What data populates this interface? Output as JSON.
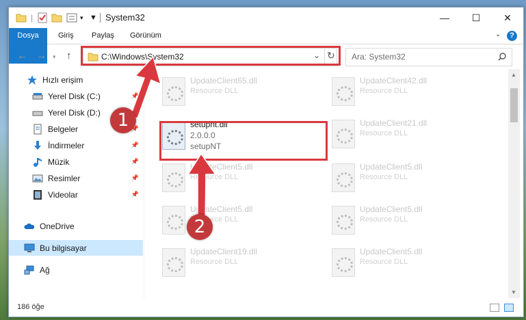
{
  "window": {
    "title": "System32",
    "controls": {
      "minimize": "—",
      "maximize": "☐",
      "close": "✕"
    }
  },
  "ribbon": {
    "tabs": [
      "Dosya",
      "Giriş",
      "Paylaş",
      "Görünüm"
    ],
    "help": "?"
  },
  "nav": {
    "address": "C:\\Windows\\System32",
    "search_placeholder": "Ara: System32"
  },
  "sidebar": {
    "items": [
      {
        "label": "Hızlı erişim",
        "icon": "star-icon",
        "pinned": false
      },
      {
        "label": "Yerel Disk (C:)",
        "icon": "drive-icon",
        "pinned": true
      },
      {
        "label": "Yerel Disk (D:)",
        "icon": "drive-icon",
        "pinned": true
      },
      {
        "label": "Belgeler",
        "icon": "documents-icon",
        "pinned": true
      },
      {
        "label": "İndirmeler",
        "icon": "downloads-icon",
        "pinned": true
      },
      {
        "label": "Müzik",
        "icon": "music-icon",
        "pinned": true
      },
      {
        "label": "Resimler",
        "icon": "pictures-icon",
        "pinned": true
      },
      {
        "label": "Videolar",
        "icon": "videos-icon",
        "pinned": true
      },
      {
        "label": "OneDrive",
        "icon": "cloud-icon",
        "pinned": false
      },
      {
        "label": "Bu bilgisayar",
        "icon": "computer-icon",
        "pinned": false,
        "selected": true
      },
      {
        "label": "Ağ",
        "icon": "network-icon",
        "pinned": false
      }
    ]
  },
  "files": [
    {
      "name": "UpdateClient65.dll",
      "desc": "Resource DLL"
    },
    {
      "name": "UpdateClient42.dll",
      "desc": "Resource DLL"
    },
    {
      "name": "setupnt.dll",
      "version": "2.0.0.0",
      "product": "setupNT",
      "featured": true
    },
    {
      "name": "UpdateClient21.dll",
      "desc": "Resource DLL"
    },
    {
      "name": "UpdateClient5.dll",
      "desc": "Resource DLL"
    },
    {
      "name": "UpdateClient5.dll",
      "desc": "Resource DLL"
    },
    {
      "name": "UpdateClient5.dll",
      "desc": "Resource DLL"
    },
    {
      "name": "UpdateClient5.dll",
      "desc": "Resource DLL"
    },
    {
      "name": "UpdateClient19.dll",
      "desc": "Resource DLL"
    },
    {
      "name": "UpdateClient5.dll",
      "desc": "Resource DLL"
    }
  ],
  "status": {
    "count": "186 öğe"
  },
  "annotations": {
    "step1": "1",
    "step2": "2",
    "color": "#d9393e"
  }
}
